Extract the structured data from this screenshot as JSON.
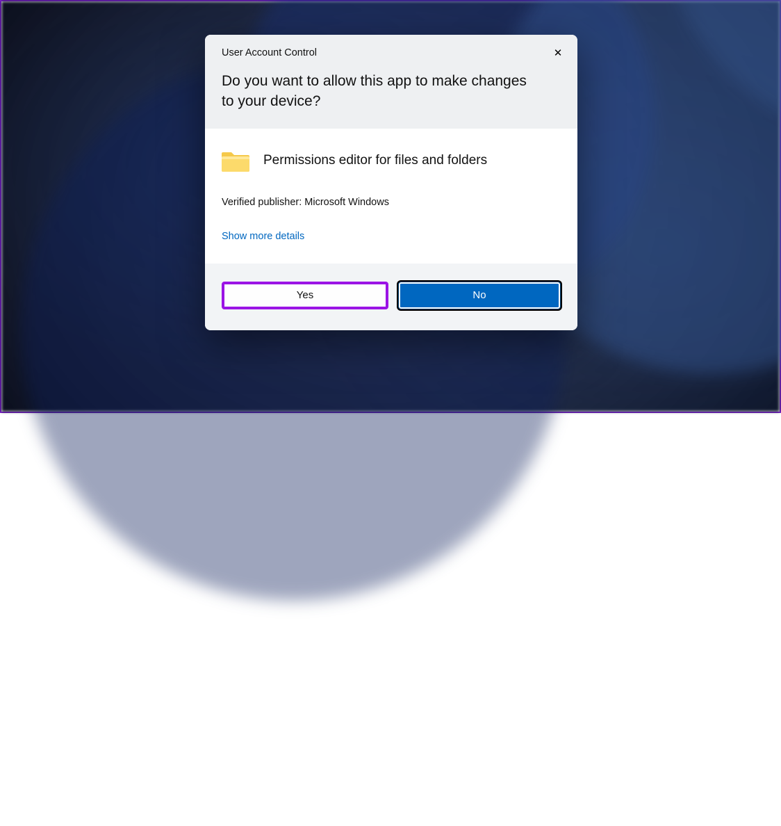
{
  "dialog": {
    "title": "User Account Control",
    "question": "Do you want to allow this app to make changes to your device?",
    "app_name": "Permissions editor for files and folders",
    "publisher_line": "Verified publisher: Microsoft Windows",
    "more_details": "Show more details",
    "close_glyph": "✕",
    "yes_label": "Yes",
    "no_label": "No"
  },
  "colors": {
    "accent_blue": "#0067c0",
    "highlight_purple": "#9b14e5",
    "link": "#0067c0"
  }
}
